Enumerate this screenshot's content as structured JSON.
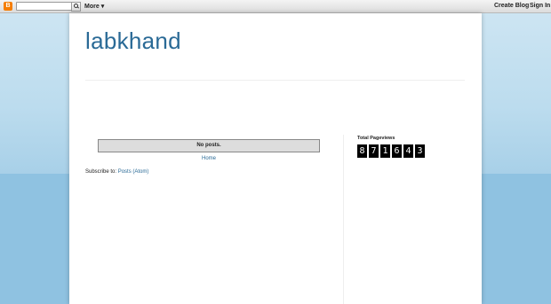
{
  "navbar": {
    "logo": "B",
    "search_value": "",
    "more_label": "More",
    "create_blog_label": "Create Blog",
    "sign_in_label": "Sign In"
  },
  "blog": {
    "title": "labkhand"
  },
  "main": {
    "no_posts_text": "No posts.",
    "home_link": "Home",
    "subscribe_prefix": "Subscribe to:",
    "subscribe_link": "Posts (Atom)"
  },
  "sidebar": {
    "pageviews_title": "Total Pageviews",
    "counter_digits": [
      "8",
      "7",
      "1",
      "6",
      "4",
      "3"
    ]
  },
  "colors": {
    "link": "#2a6a96",
    "background_blue": "#8fc2e1"
  }
}
